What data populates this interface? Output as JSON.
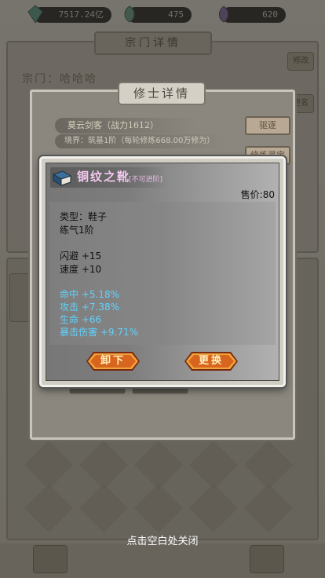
{
  "resources": [
    {
      "icon": "green-crystal-icon",
      "value": "7517.24亿"
    },
    {
      "icon": "green-leaf-icon",
      "value": "475"
    },
    {
      "icon": "purple-gem-icon",
      "value": "620"
    }
  ],
  "background": {
    "sect_label": "宗门：哈哈哈"
  },
  "detail_panel": {
    "title": "修士详情",
    "name_line": "莫云剑客（战力1612）",
    "realm_line": "境界：筑基1阶（每轮修炼668.00万修为）",
    "right_buttons": [
      "驱逐",
      "修炼灵宝"
    ]
  },
  "item_popup": {
    "name": "铜纹之靴",
    "tag": "[不可进阶]",
    "price": "售价:80",
    "type_line": "类型：鞋子",
    "level_line": "练气1阶",
    "base_stats": [
      "闪避 +15",
      "速度 +10"
    ],
    "bonus_stats": [
      "命中 +5.18%",
      "攻击 +7.38%",
      "生命 +66",
      "暴击伤害 +9.71%"
    ],
    "unequip_label": "卸下",
    "replace_label": "更换",
    "colors": {
      "name": "#f4c8f0",
      "bonus": "#5fd3ff",
      "button": "#f0a43a"
    }
  },
  "close_hint": "点击空白处关闭"
}
